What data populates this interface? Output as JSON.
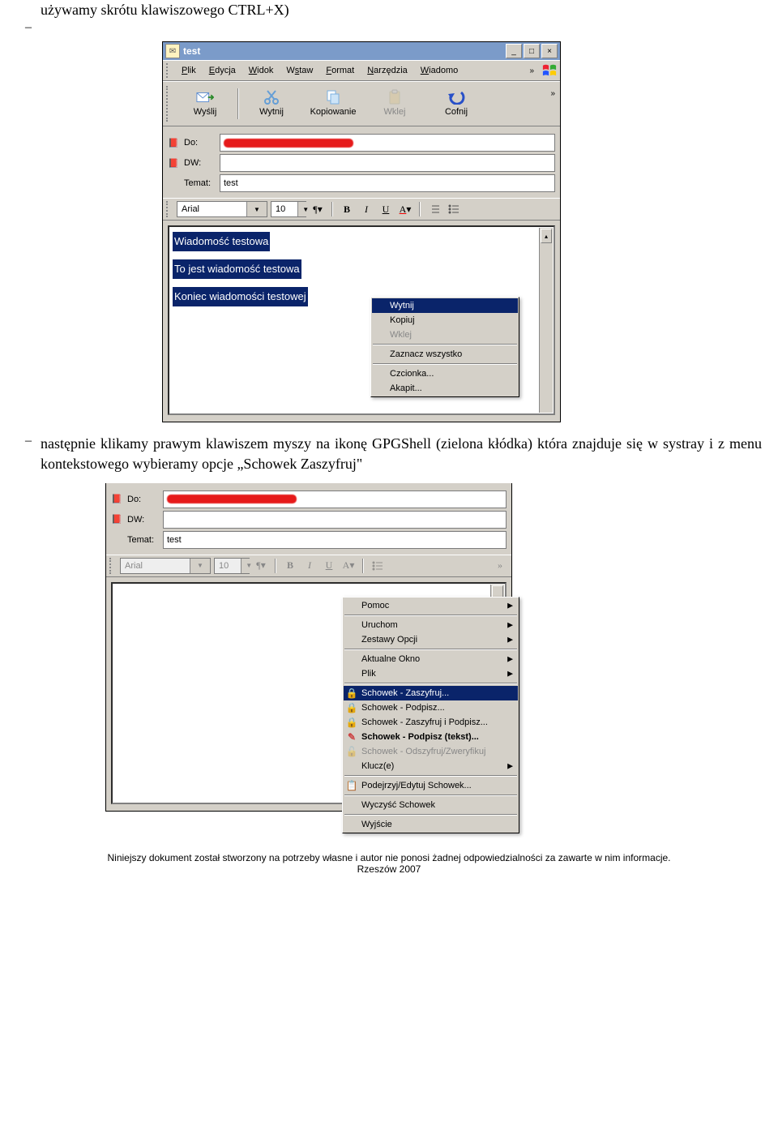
{
  "doc": {
    "intro": "używamy skrótu klawiszowego CTRL+X)",
    "step2": "następnie klikamy prawym klawiszem myszy na ikonę GPGShell (zielona kłódka) która znajduje się w systray i z menu kontekstowego wybieramy opcje „Schowek Zaszyfruj\"",
    "footer1": "Niniejszy dokument został stworzony na potrzeby własne i autor nie ponosi żadnej odpowiedzialności za zawarte w nim informacje.",
    "footer2": "Rzeszów 2007"
  },
  "win1": {
    "title": "test",
    "menu": {
      "plik": "Plik",
      "edycja": "Edycja",
      "widok": "Widok",
      "wstaw": "Wstaw",
      "format": "Format",
      "narzedzia": "Narzędzia",
      "wiadomo": "Wiadomo",
      "chev": "»"
    },
    "tool": {
      "wyslij": "Wyślij",
      "wytnij": "Wytnij",
      "kopiowanie": "Kopiowanie",
      "wklej": "Wklej",
      "cofnij": "Cofnij",
      "chev": "»"
    },
    "fields": {
      "do": "Do:",
      "dw": "DW:",
      "temat": "Temat:",
      "temat_val": "test"
    },
    "fmt": {
      "font": "Arial",
      "size": "10",
      "bold": "B",
      "italic": "I",
      "under": "U",
      "color": "A"
    },
    "body": {
      "l1": "Wiadomość testowa",
      "l2": "To jest wiadomość testowa",
      "l3": "Koniec wiadomości testowej"
    },
    "ctx": {
      "wytnij": "Wytnij",
      "kopiuj": "Kopiuj",
      "wklej": "Wklej",
      "zaznacz": "Zaznacz wszystko",
      "czcionka": "Czcionka...",
      "akapit": "Akapit..."
    }
  },
  "win2": {
    "fields": {
      "do": "Do:",
      "dw": "DW:",
      "temat": "Temat:",
      "temat_val": "test"
    },
    "fmt": {
      "font": "Arial",
      "size": "10",
      "bold": "B",
      "italic": "I",
      "under": "U",
      "color": "A",
      "chev": "»"
    },
    "ctx": {
      "pomoc": "Pomoc",
      "uruchom": "Uruchom",
      "zestawy": "Zestawy Opcji",
      "aktualne": "Aktualne Okno",
      "plik": "Plik",
      "sch_zasz": "Schowek - Zaszyfruj...",
      "sch_pod": "Schowek - Podpisz...",
      "sch_zp": "Schowek - Zaszyfruj i Podpisz...",
      "sch_pt": "Schowek - Podpisz (tekst)...",
      "sch_od": "Schowek - Odszyfruj/Zweryfikuj",
      "klucze": "Klucz(e)",
      "podejrzyj": "Podejrzyj/Edytuj Schowek...",
      "wyczysc": "Wyczyść Schowek",
      "wyjscie": "Wyjście"
    }
  }
}
